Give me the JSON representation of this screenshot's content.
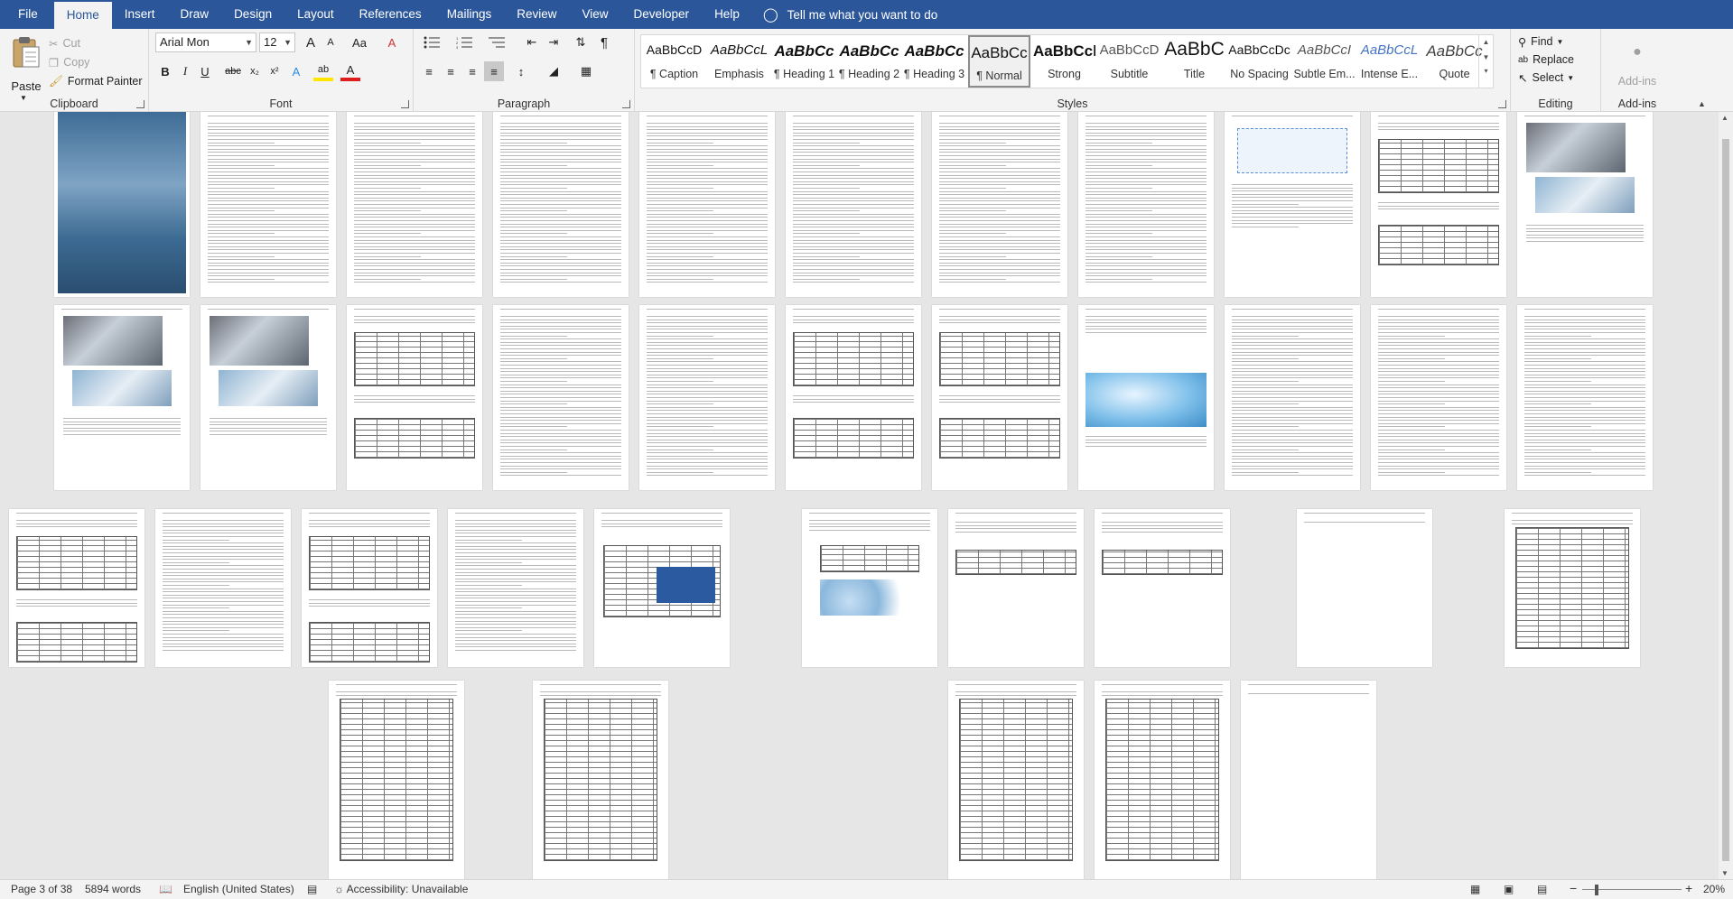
{
  "tabs": {
    "file": "File",
    "home": "Home",
    "insert": "Insert",
    "draw": "Draw",
    "design": "Design",
    "layout": "Layout",
    "references": "References",
    "mailings": "Mailings",
    "review": "Review",
    "view": "View",
    "developer": "Developer",
    "help": "Help"
  },
  "tellme": "Tell me what you want to do",
  "clipboard": {
    "paste": "Paste",
    "cut": "Cut",
    "copy": "Copy",
    "format_painter": "Format Painter",
    "label": "Clipboard"
  },
  "font": {
    "name": "Arial Mon",
    "size": "12",
    "label": "Font",
    "bold": "B",
    "italic": "I",
    "underline": "U",
    "strike": "abc",
    "sub": "x₂",
    "sup": "x²",
    "grow": "A",
    "shrink": "A",
    "case": "Aa",
    "color_a": "A",
    "highlight": "ab",
    "clear": "A"
  },
  "paragraph": {
    "label": "Paragraph"
  },
  "styles": {
    "label": "Styles",
    "items": [
      {
        "preview": "AaBbCcD",
        "name": "¶ Caption"
      },
      {
        "preview": "AaBbCcL",
        "name": "Emphasis"
      },
      {
        "preview": "AaBbCc",
        "name": "¶ Heading 1"
      },
      {
        "preview": "AaBbCc",
        "name": "¶ Heading 2"
      },
      {
        "preview": "AaBbCc",
        "name": "¶ Heading 3"
      },
      {
        "preview": "AaBbCc",
        "name": "¶ Normal"
      },
      {
        "preview": "AaBbCcl",
        "name": "Strong"
      },
      {
        "preview": "AaBbCcD",
        "name": "Subtitle"
      },
      {
        "preview": "AaBbC",
        "name": "Title"
      },
      {
        "preview": "AaBbCcDc",
        "name": "No Spacing"
      },
      {
        "preview": "AaBbCcI",
        "name": "Subtle Em..."
      },
      {
        "preview": "AaBbCcL",
        "name": "Intense E..."
      },
      {
        "preview": "AaBbCc",
        "name": "Quote"
      }
    ]
  },
  "editing": {
    "find": "Find",
    "replace": "Replace",
    "select": "Select",
    "label": "Editing"
  },
  "addins": {
    "button": "Add-ins",
    "label": "Add-ins"
  },
  "statusbar": {
    "page": "Page 3 of 38",
    "words": "5894 words",
    "language": "English (United States)",
    "accessibility": "Accessibility: Unavailable",
    "zoom": "20%"
  }
}
